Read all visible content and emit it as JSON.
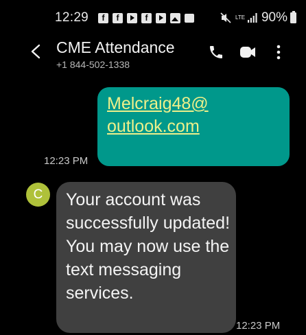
{
  "status_bar": {
    "time": "12:29",
    "notification_icons": [
      "facebook-icon",
      "facebook-icon",
      "youtube-icon",
      "facebook-icon",
      "youtube-icon",
      "gallery-icon",
      "exchange-icon"
    ],
    "network": "LTE",
    "battery": "90%"
  },
  "header": {
    "contact_name": "CME Attendance",
    "contact_number": "+1 844-502-1338",
    "icons": [
      "back-icon",
      "call-icon",
      "video-call-icon",
      "more-options-icon"
    ]
  },
  "messages": [
    {
      "direction": "outgoing",
      "text": "Melcraig48@outlook.com",
      "time": "12:23 PM"
    },
    {
      "direction": "incoming",
      "avatar_letter": "C",
      "text": "Your account was successfully updated!  You may now use the text messaging services.",
      "time": "12:23 PM"
    }
  ],
  "colors": {
    "background": "#000000",
    "outgoing_bubble": "#00988b",
    "outgoing_link": "#eef08a",
    "incoming_bubble": "#404040",
    "avatar": "#afc13a"
  }
}
